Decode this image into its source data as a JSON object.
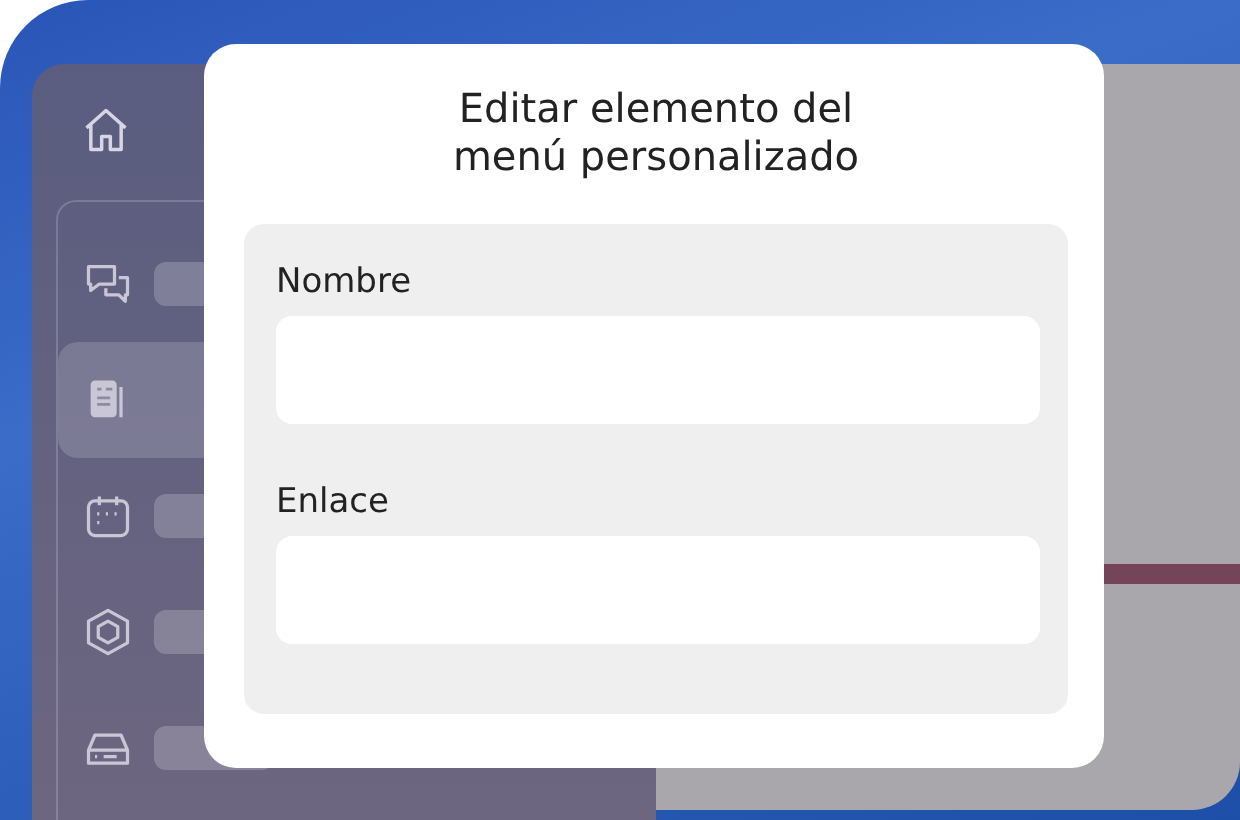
{
  "sidebar": {
    "items": [
      {
        "selected": false
      },
      {
        "selected": true
      },
      {
        "selected": false
      },
      {
        "selected": false
      },
      {
        "selected": false
      }
    ]
  },
  "dialog": {
    "title": "Editar elemento del menú personalizado",
    "fields": [
      {
        "label": "Nombre"
      },
      {
        "label": "Enlace"
      }
    ]
  }
}
